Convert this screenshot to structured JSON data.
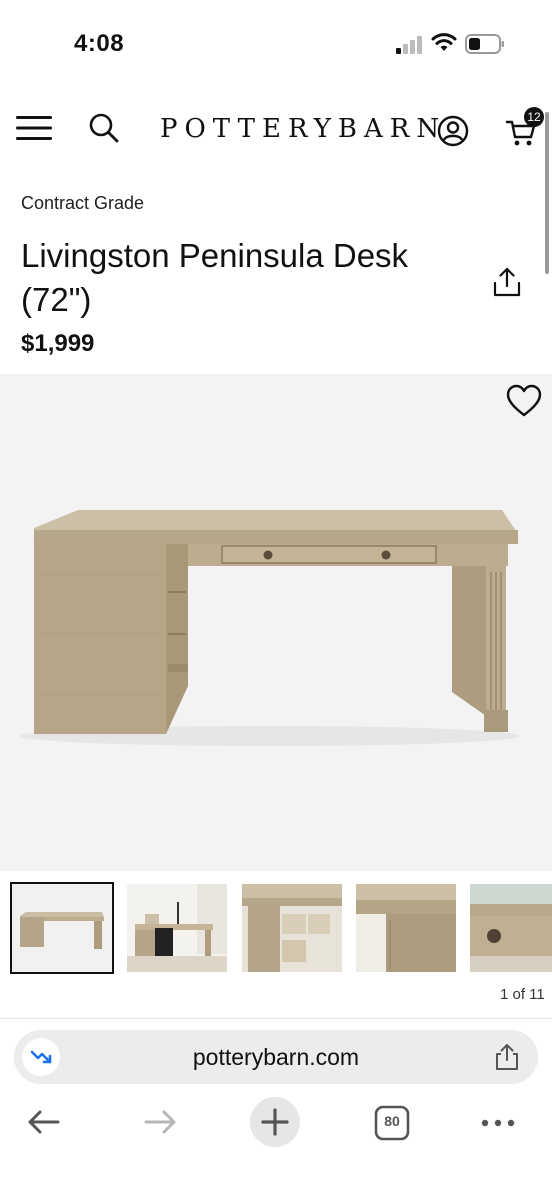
{
  "status_bar": {
    "time": "4:08"
  },
  "header": {
    "logo_text": "POTTERYBARN",
    "cart_count": "12",
    "icons": [
      "menu-icon",
      "search-icon",
      "account-icon",
      "cart-icon"
    ]
  },
  "product": {
    "eyebrow": "Contract Grade",
    "title": "Livingston Peninsula Desk (72\")",
    "price": "$1,999",
    "image_count": "1 of 11"
  },
  "browser": {
    "url": "potterybarn.com",
    "tab_count": "80",
    "accent": "#1a73e8"
  },
  "colors": {
    "wood": "#b8a88a",
    "wood_dark": "#8f7f62",
    "hero_bg": "#f3f3f3"
  }
}
